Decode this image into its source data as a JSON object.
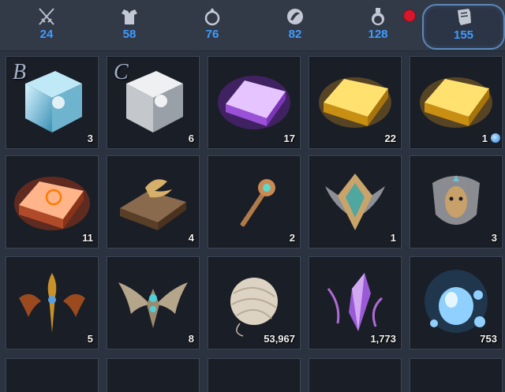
{
  "tabs": [
    {
      "icon": "crossed-swords-icon",
      "count": "24"
    },
    {
      "icon": "armor-icon",
      "count": "58"
    },
    {
      "icon": "ring-icon",
      "count": "76"
    },
    {
      "icon": "orb-icon",
      "count": "82"
    },
    {
      "icon": "potion-icon",
      "count": "128"
    },
    {
      "icon": "scroll-icon",
      "count": "155",
      "active": true
    }
  ],
  "items": [
    {
      "name": "blue-crystal-cube",
      "grade": "B",
      "quantity": "3"
    },
    {
      "name": "white-crystal-cube",
      "grade": "C",
      "quantity": "6"
    },
    {
      "name": "purple-ingot",
      "quantity": "17"
    },
    {
      "name": "gold-ingot",
      "quantity": "22"
    },
    {
      "name": "gold-ingot-bound",
      "quantity": "1"
    },
    {
      "name": "red-rune-ingot",
      "quantity": "11"
    },
    {
      "name": "winged-tome",
      "quantity": "4"
    },
    {
      "name": "bronze-key",
      "quantity": "2"
    },
    {
      "name": "crest-emblem",
      "quantity": "1"
    },
    {
      "name": "mask-emblem",
      "quantity": "3"
    },
    {
      "name": "dragon-horn-emblem",
      "quantity": "5"
    },
    {
      "name": "winged-gem-emblem",
      "quantity": "8"
    },
    {
      "name": "yarn-ball",
      "quantity": "53,967"
    },
    {
      "name": "purple-crystal-shard",
      "quantity": "1,773"
    },
    {
      "name": "water-spirit-orb",
      "quantity": "753"
    }
  ],
  "colors": {
    "tab_count": "#3f9cff",
    "alert": "#d6162b"
  }
}
